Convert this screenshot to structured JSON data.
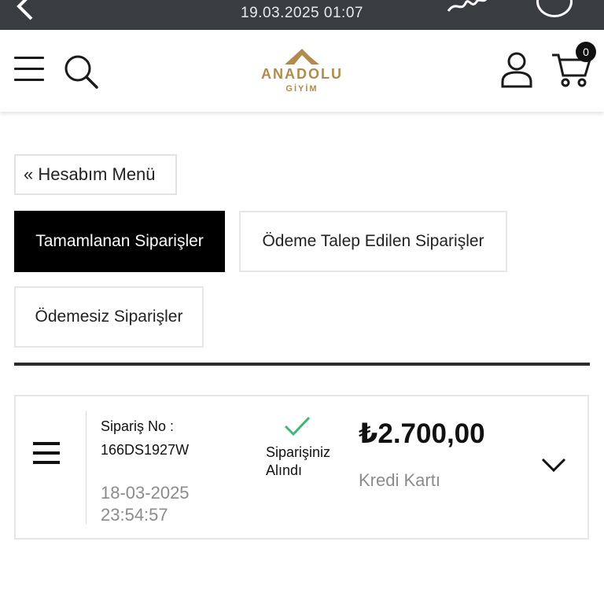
{
  "status_bar": {
    "datetime": "19.03.2025 01:07"
  },
  "header": {
    "logo": {
      "brand": "ANADOLU",
      "sub": "GİYİM"
    },
    "cart_count": "0"
  },
  "account_menu_label": "« Hesabım Menü",
  "tabs": [
    {
      "label": "Tamamlanan Siparişler",
      "active": true
    },
    {
      "label": "Ödeme Talep Edilen Siparişler",
      "active": false
    },
    {
      "label": "Ödemesiz Siparişler",
      "active": false
    }
  ],
  "order": {
    "no_label": "Sipariş No :",
    "no_value": "166DS1927W",
    "date": "18-03-2025",
    "time": "23:54:57",
    "status": "Siparişiniz Alındı",
    "price": "₺2.700,00",
    "payment_method": "Kredi Kartı"
  },
  "colors": {
    "brand_gold": "#b38a4a",
    "check_green": "#3cb878",
    "dark": "#111111"
  }
}
